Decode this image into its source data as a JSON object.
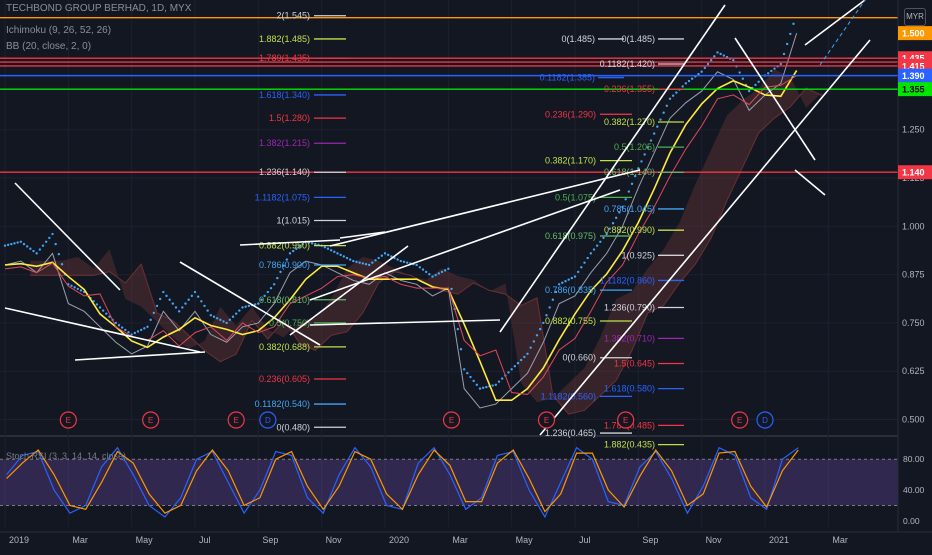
{
  "header": {
    "symbol_line": "TECHBOND GROUP BERHAD, 1D, MYX",
    "ichimoku_line": "Ichimoku (9, 26, 52, 26)",
    "bb_line": "BB (20, close, 2, 0)",
    "currency": "MYR"
  },
  "chart_data": [
    {
      "type": "line",
      "title": "TECHBOND GROUP BERHAD, 1D, MYX",
      "y_axis": {
        "ticks": [
          1.25,
          1.125,
          1.0,
          0.875,
          0.75,
          0.625,
          0.5
        ],
        "tick_labels": [
          "1.250",
          "1.125",
          "1.000",
          "0.875",
          "0.750",
          "0.625",
          "0.500"
        ],
        "range": [
          0.46,
          1.565
        ]
      },
      "x_axis": {
        "tick_labels": [
          "2019",
          "Mar",
          "May",
          "Jul",
          "Sep",
          "Nov",
          "2020",
          "Mar",
          "May",
          "Jul",
          "Sep",
          "Nov",
          "2021",
          "Mar"
        ],
        "tick_times": [
          0,
          2,
          4,
          6,
          8,
          10,
          12,
          14,
          16,
          18,
          20,
          22,
          24,
          26
        ]
      },
      "price_series": {
        "name": "Close",
        "t": [
          0,
          0.5,
          1,
          1.5,
          2,
          2.5,
          3,
          3.5,
          4,
          4.5,
          5,
          5.5,
          6,
          6.5,
          7,
          7.5,
          8,
          8.5,
          9,
          9.5,
          10,
          10.5,
          11,
          11.5,
          12,
          12.5,
          13,
          13.5,
          14,
          14.5,
          15,
          15.5,
          16,
          16.5,
          17,
          17.5,
          18,
          18.5,
          19,
          19.5,
          20,
          20.5,
          21,
          21.5,
          22,
          22.5,
          23,
          23.5,
          24,
          24.5,
          25
        ],
        "values": [
          0.9,
          0.91,
          0.88,
          0.93,
          0.8,
          0.78,
          0.74,
          0.7,
          0.67,
          0.69,
          0.78,
          0.73,
          0.78,
          0.72,
          0.7,
          0.74,
          0.75,
          0.8,
          0.88,
          0.91,
          0.9,
          0.88,
          0.86,
          0.85,
          0.88,
          0.86,
          0.85,
          0.82,
          0.84,
          0.58,
          0.53,
          0.54,
          0.58,
          0.62,
          0.7,
          0.8,
          0.82,
          0.88,
          0.93,
          1.0,
          1.1,
          1.19,
          1.28,
          1.32,
          1.35,
          1.4,
          1.38,
          1.3,
          1.34,
          1.37,
          1.5
        ]
      },
      "price_markers": [
        {
          "label": "1.500",
          "value": 1.5,
          "color": "#ff9800",
          "text_color": "#ffffff"
        },
        {
          "label": "1.435",
          "value": 1.435,
          "color": "#f23645",
          "text_color": "#ffffff"
        },
        {
          "label": "1.415",
          "value": 1.415,
          "color": "#f23645",
          "text_color": "#ffffff"
        },
        {
          "label": "1.390",
          "value": 1.39,
          "color": "#2962ff",
          "text_color": "#ffffff"
        },
        {
          "label": "1.355",
          "value": 1.355,
          "color": "#00e600",
          "text_color": "#000000"
        },
        {
          "label": "1.140",
          "value": 1.14,
          "color": "#f23645",
          "text_color": "#ffffff"
        }
      ],
      "horizontal_levels": [
        {
          "value": 1.54,
          "color": "#ff9800"
        },
        {
          "value": 1.435,
          "color": "#f23645"
        },
        {
          "value": 1.425,
          "color": "#f23645"
        },
        {
          "value": 1.415,
          "color": "#f23645"
        },
        {
          "value": 1.39,
          "color": "#2962ff"
        },
        {
          "value": 1.355,
          "color": "#00e600"
        },
        {
          "value": 1.14,
          "color": "#f23645"
        }
      ],
      "fib_left": [
        {
          "label": "2(1.545)",
          "value": 1.545,
          "color": "#d1d4dc"
        },
        {
          "label": "1.882(1.485)",
          "value": 1.485,
          "color": "#c0e04a"
        },
        {
          "label": "1.789(1.435)",
          "value": 1.435,
          "color": "#f23645"
        },
        {
          "label": "1.618(1.340)",
          "value": 1.34,
          "color": "#2962ff"
        },
        {
          "label": "1.5(1.280)",
          "value": 1.28,
          "color": "#f23645"
        },
        {
          "label": "1.382(1.215)",
          "value": 1.215,
          "color": "#9c27b0"
        },
        {
          "label": "1.236(1.140)",
          "value": 1.14,
          "color": "#d1d4dc"
        },
        {
          "label": "1.1182(1.075)",
          "value": 1.075,
          "color": "#2962ff"
        },
        {
          "label": "1(1.015)",
          "value": 1.015,
          "color": "#d1d4dc"
        },
        {
          "label": "0.882(0.950)",
          "value": 0.95,
          "color": "#c0e04a"
        },
        {
          "label": "0.786(0.900)",
          "value": 0.9,
          "color": "#42a5f5"
        },
        {
          "label": "0.618(0.810)",
          "value": 0.81,
          "color": "#66bb6a"
        },
        {
          "label": "0.5(0.750)",
          "value": 0.75,
          "color": "#4caf50"
        },
        {
          "label": "0.382(0.688)",
          "value": 0.688,
          "color": "#c0e04a"
        },
        {
          "label": "0.236(0.605)",
          "value": 0.605,
          "color": "#f23645"
        },
        {
          "label": "0.1182(0.540)",
          "value": 0.54,
          "color": "#42a5f5"
        },
        {
          "label": "0(0.480)",
          "value": 0.48,
          "color": "#d1d4dc"
        }
      ],
      "fib_mid": [
        {
          "label": "0.236(1.290)",
          "value": 1.29,
          "color": "#f23645"
        },
        {
          "label": "0.382(1.170)",
          "value": 1.17,
          "color": "#c0e04a"
        },
        {
          "label": "0.5(1.075)",
          "value": 1.075,
          "color": "#4caf50"
        },
        {
          "label": "0.618(0.975)",
          "value": 0.975,
          "color": "#66bb6a"
        },
        {
          "label": "0.786(0.835)",
          "value": 0.835,
          "color": "#42a5f5"
        },
        {
          "label": "0.882(0.755)",
          "value": 0.755,
          "color": "#c0e04a"
        },
        {
          "label": "0(0.660)",
          "value": 0.66,
          "color": "#d1d4dc"
        },
        {
          "label": "1.1182(0.560)",
          "value": 0.56,
          "color": "#2962ff"
        },
        {
          "label": "1.236(0.465)",
          "value": 0.465,
          "color": "#d1d4dc"
        }
      ],
      "fib_right": [
        {
          "label": "0(1.485)",
          "value": 1.485,
          "color": "#d1d4dc"
        },
        {
          "label": "0.1182(1.420)",
          "value": 1.42,
          "color": "#d1d4dc"
        },
        {
          "label": "0.236(1.355)",
          "value": 1.355,
          "color": "#f23645"
        },
        {
          "label": "0.382(1.270)",
          "value": 1.27,
          "color": "#c0e04a"
        },
        {
          "label": "0.5(1.205)",
          "value": 1.205,
          "color": "#4caf50"
        },
        {
          "label": "0.618(1.140)",
          "value": 1.14,
          "color": "#66bb6a"
        },
        {
          "label": "0.786(1.045)",
          "value": 1.045,
          "color": "#42a5f5"
        },
        {
          "label": "0.882(0.990)",
          "value": 0.99,
          "color": "#c0e04a"
        },
        {
          "label": "1(0.925)",
          "value": 0.925,
          "color": "#d1d4dc"
        },
        {
          "label": "1.1182(0.860)",
          "value": 0.86,
          "color": "#2962ff"
        },
        {
          "label": "1.236(0.790)",
          "value": 0.79,
          "color": "#d1d4dc"
        },
        {
          "label": "1.382(0.710)",
          "value": 0.71,
          "color": "#9c27b0"
        },
        {
          "label": "1.5(0.645)",
          "value": 0.645,
          "color": "#f23645"
        },
        {
          "label": "1.618(0.580)",
          "value": 0.58,
          "color": "#2962ff"
        },
        {
          "label": "1.789(0.485)",
          "value": 0.485,
          "color": "#f23645"
        },
        {
          "label": "1.882(0.435)",
          "value": 0.435,
          "color": "#c0e04a"
        }
      ],
      "fib_right2": [
        {
          "label": "0(1.485)",
          "value": 1.485,
          "color": "#d1d4dc"
        },
        {
          "label": "0.1182(1.385)",
          "value": 1.385,
          "color": "#2962ff"
        }
      ],
      "event_markers": [
        {
          "label": "E",
          "t": 2.0,
          "color": "#f23645"
        },
        {
          "label": "E",
          "t": 4.6,
          "color": "#f23645"
        },
        {
          "label": "E",
          "t": 7.3,
          "color": "#f23645"
        },
        {
          "label": "D",
          "t": 8.3,
          "color": "#2962ff"
        },
        {
          "label": "E",
          "t": 14.1,
          "color": "#f23645"
        },
        {
          "label": "E",
          "t": 17.1,
          "color": "#f23645"
        },
        {
          "label": "E",
          "t": 19.6,
          "color": "#f23645"
        },
        {
          "label": "E",
          "t": 23.2,
          "color": "#f23645"
        },
        {
          "label": "D",
          "t": 24.0,
          "color": "#2962ff"
        }
      ]
    },
    {
      "type": "line",
      "title": "Stoch RSI (3, 3, 14, 14, close)",
      "y_axis": {
        "ticks": [
          80,
          40,
          0
        ],
        "tick_labels": [
          "80.00",
          "40.00",
          "0.00"
        ],
        "range": [
          -8,
          105
        ],
        "bands": [
          80,
          20
        ]
      },
      "series": [
        {
          "color": "#2962ff",
          "values": [
            60,
            85,
            90,
            40,
            10,
            20,
            70,
            95,
            60,
            20,
            5,
            30,
            80,
            90,
            50,
            10,
            40,
            90,
            85,
            30,
            10,
            60,
            95,
            70,
            20,
            15,
            75,
            95,
            60,
            15,
            30,
            85,
            90,
            40,
            5,
            50,
            95,
            80,
            25,
            20,
            70,
            90,
            55,
            10,
            45,
            95,
            85,
            30,
            15,
            80,
            95
          ]
        },
        {
          "color": "#ff9800",
          "values": [
            55,
            75,
            92,
            60,
            20,
            15,
            50,
            90,
            75,
            35,
            10,
            20,
            65,
            92,
            65,
            20,
            30,
            80,
            90,
            45,
            15,
            45,
            90,
            80,
            35,
            15,
            60,
            92,
            72,
            25,
            25,
            75,
            92,
            55,
            12,
            35,
            88,
            88,
            40,
            18,
            58,
            92,
            65,
            20,
            35,
            88,
            90,
            45,
            18,
            65,
            92
          ]
        }
      ]
    }
  ]
}
